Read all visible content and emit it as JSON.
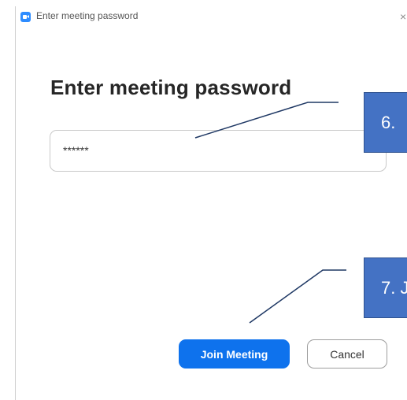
{
  "window": {
    "title": "Enter meeting password",
    "close_glyph": "×",
    "icon": "zoom-camera-icon",
    "close_icon": "close-icon"
  },
  "dialog": {
    "heading": "Enter meeting password",
    "password_value": "******",
    "join_label": "Join Meeting",
    "cancel_label": "Cancel"
  },
  "callouts": {
    "step6": "6.",
    "step7": "7. J"
  },
  "colors": {
    "primary_button": "#0e72ed",
    "callout_fill": "#4472c4",
    "leader_line": "#1f3864",
    "zoom_icon": "#2d8cff"
  }
}
